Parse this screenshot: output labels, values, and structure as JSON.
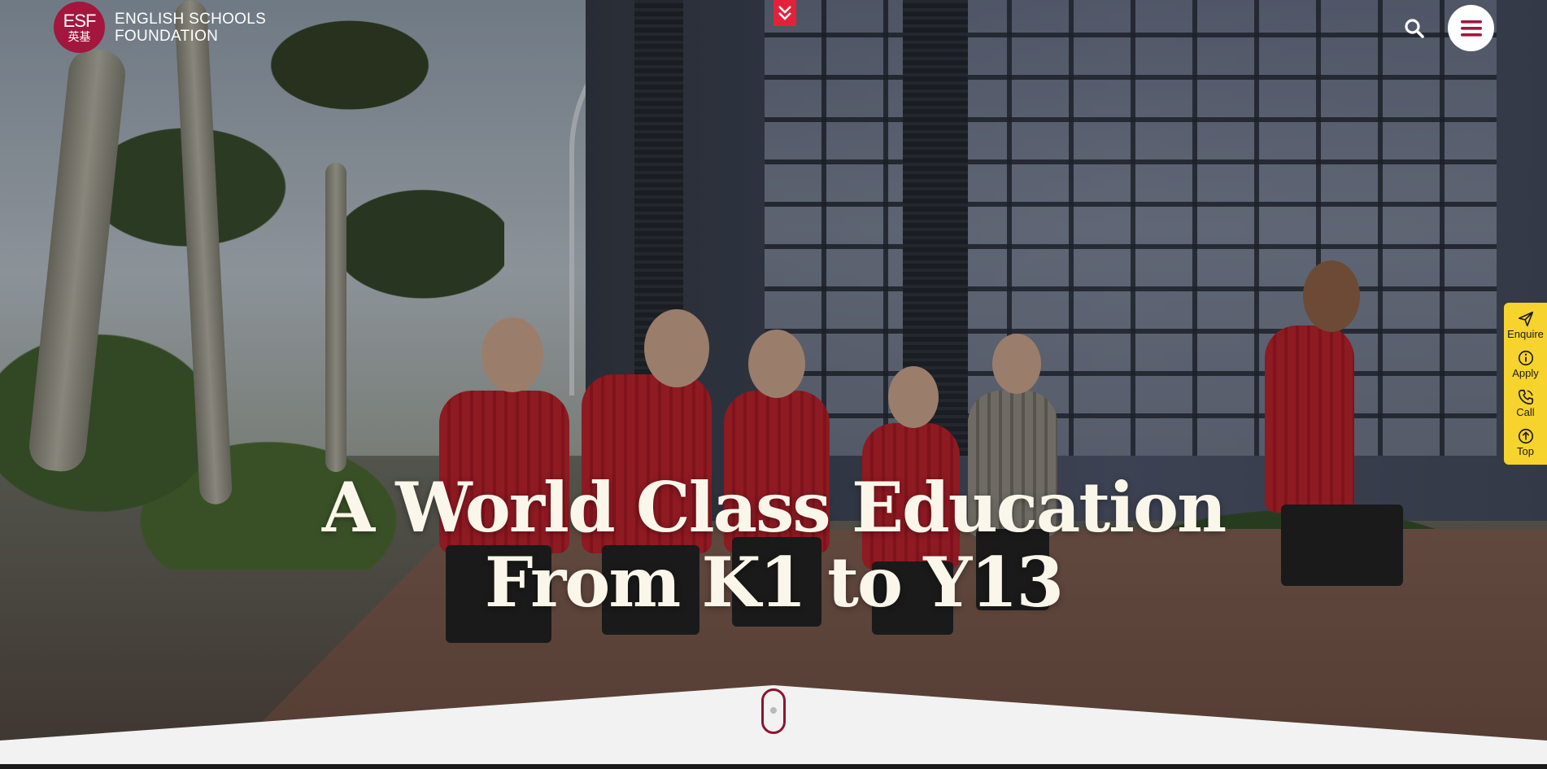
{
  "header": {
    "logo_abbr": "ESF",
    "logo_chinese": "英基",
    "logo_line1": "ENGLISH SCHOOLS",
    "logo_line2": "FOUNDATION",
    "search_icon": "search-icon",
    "menu_icon": "hamburger-menu-icon",
    "scroll_icon": "double-chevron-down-icon"
  },
  "hero": {
    "headline_line1": "A World Class Education",
    "headline_line2": "From K1 to Y13"
  },
  "quick_actions": [
    {
      "label": "Enquire",
      "icon": "paper-plane-icon"
    },
    {
      "label": "Apply",
      "icon": "info-circle-icon"
    },
    {
      "label": "Call",
      "icon": "phone-icon"
    },
    {
      "label": "Top",
      "icon": "arrow-up-circle-icon"
    }
  ],
  "colors": {
    "brand": "#a3163d",
    "quick_bar": "#f6d32d",
    "scroll_flag": "#e4213a",
    "headline": "#fbf6ea"
  }
}
